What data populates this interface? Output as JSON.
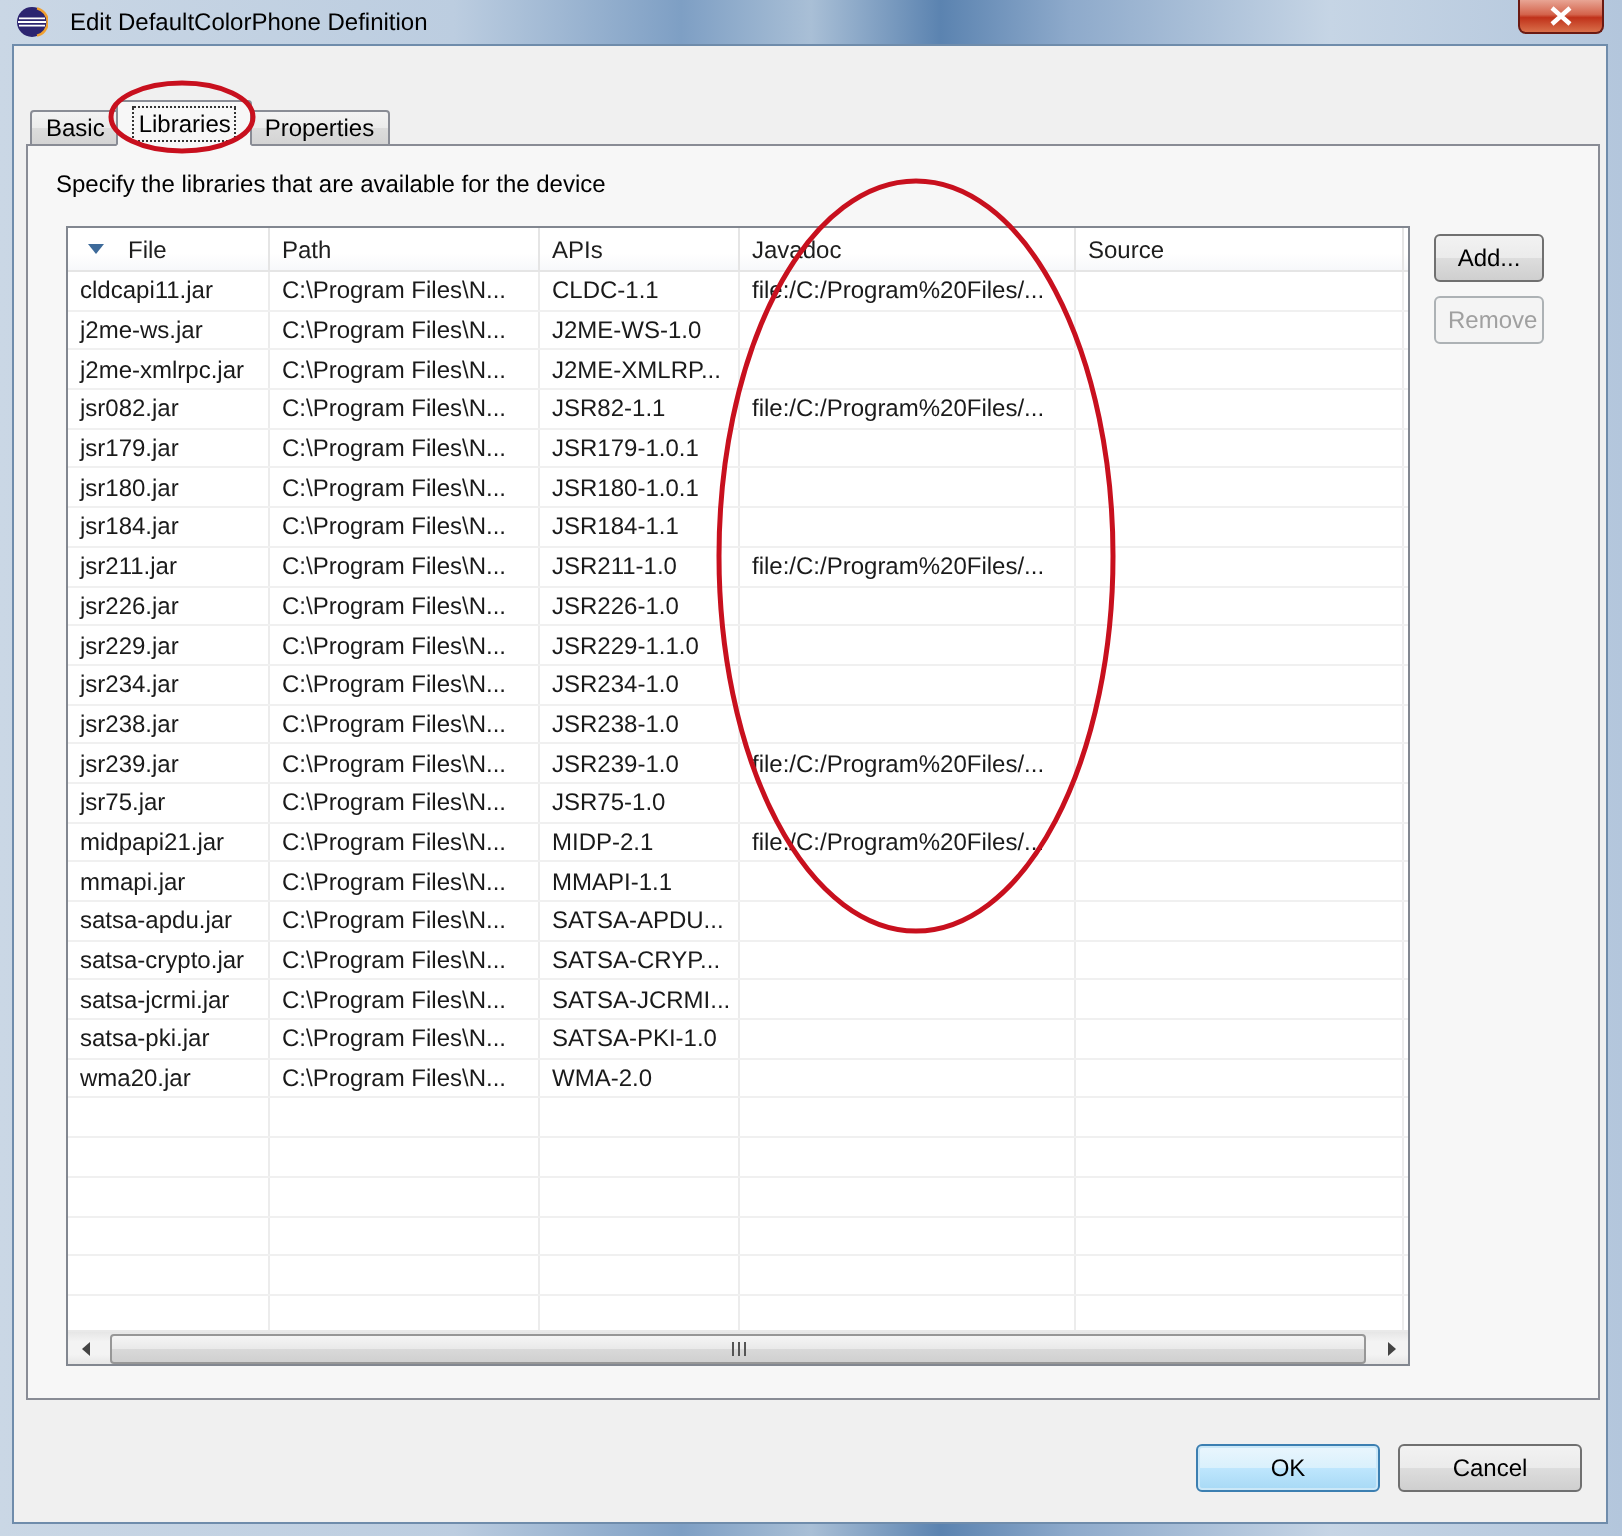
{
  "window": {
    "title": "Edit DefaultColorPhone Definition"
  },
  "tabs": [
    {
      "label": "Basic",
      "selected": false,
      "circled": false
    },
    {
      "label": "Libraries",
      "selected": true,
      "circled": true
    },
    {
      "label": "Properties",
      "selected": false,
      "circled": false
    }
  ],
  "libraries_panel": {
    "description": "Specify the libraries that are available for the device",
    "table": {
      "columns": [
        {
          "label": "File",
          "sorted": true,
          "circled": false
        },
        {
          "label": "Path",
          "sorted": false,
          "circled": false
        },
        {
          "label": "APIs",
          "sorted": false,
          "circled": false
        },
        {
          "label": "Javadoc",
          "sorted": false,
          "circled": true
        },
        {
          "label": "Source",
          "sorted": false,
          "circled": false
        }
      ],
      "rows": [
        {
          "file": "cldcapi11.jar",
          "path": "C:\\Program Files\\N...",
          "apis": "CLDC-1.1",
          "javadoc": "file:/C:/Program%20Files/..."
        },
        {
          "file": "j2me-ws.jar",
          "path": "C:\\Program Files\\N...",
          "apis": "J2ME-WS-1.0"
        },
        {
          "file": "j2me-xmlrpc.jar",
          "path": "C:\\Program Files\\N...",
          "apis": "J2ME-XMLRP..."
        },
        {
          "file": "jsr082.jar",
          "path": "C:\\Program Files\\N...",
          "apis": "JSR82-1.1",
          "javadoc": "file:/C:/Program%20Files/..."
        },
        {
          "file": "jsr179.jar",
          "path": "C:\\Program Files\\N...",
          "apis": "JSR179-1.0.1"
        },
        {
          "file": "jsr180.jar",
          "path": "C:\\Program Files\\N...",
          "apis": "JSR180-1.0.1"
        },
        {
          "file": "jsr184.jar",
          "path": "C:\\Program Files\\N...",
          "apis": "JSR184-1.1"
        },
        {
          "file": "jsr211.jar",
          "path": "C:\\Program Files\\N...",
          "apis": "JSR211-1.0",
          "javadoc": "file:/C:/Program%20Files/..."
        },
        {
          "file": "jsr226.jar",
          "path": "C:\\Program Files\\N...",
          "apis": "JSR226-1.0"
        },
        {
          "file": "jsr229.jar",
          "path": "C:\\Program Files\\N...",
          "apis": "JSR229-1.1.0"
        },
        {
          "file": "jsr234.jar",
          "path": "C:\\Program Files\\N...",
          "apis": "JSR234-1.0"
        },
        {
          "file": "jsr238.jar",
          "path": "C:\\Program Files\\N...",
          "apis": "JSR238-1.0"
        },
        {
          "file": "jsr239.jar",
          "path": "C:\\Program Files\\N...",
          "apis": "JSR239-1.0",
          "javadoc": "file:/C:/Program%20Files/..."
        },
        {
          "file": "jsr75.jar",
          "path": "C:\\Program Files\\N...",
          "apis": "JSR75-1.0"
        },
        {
          "file": "midpapi21.jar",
          "path": "C:\\Program Files\\N...",
          "apis": "MIDP-2.1",
          "javadoc": "file:/C:/Program%20Files/..."
        },
        {
          "file": "mmapi.jar",
          "path": "C:\\Program Files\\N...",
          "apis": "MMAPI-1.1"
        },
        {
          "file": "satsa-apdu.jar",
          "path": "C:\\Program Files\\N...",
          "apis": "SATSA-APDU..."
        },
        {
          "file": "satsa-crypto.jar",
          "path": "C:\\Program Files\\N...",
          "apis": "SATSA-CRYP..."
        },
        {
          "file": "satsa-jcrmi.jar",
          "path": "C:\\Program Files\\N...",
          "apis": "SATSA-JCRMI..."
        },
        {
          "file": "satsa-pki.jar",
          "path": "C:\\Program Files\\N...",
          "apis": "SATSA-PKI-1.0"
        },
        {
          "file": "wma20.jar",
          "path": "C:\\Program Files\\N...",
          "apis": "WMA-2.0"
        }
      ]
    },
    "side_buttons": [
      {
        "label": "Add...",
        "disabled": false
      },
      {
        "label": "Remove",
        "disabled": true
      }
    ]
  },
  "dialog_buttons": [
    {
      "label": "OK",
      "default": true
    },
    {
      "label": "Cancel",
      "default": false
    }
  ]
}
